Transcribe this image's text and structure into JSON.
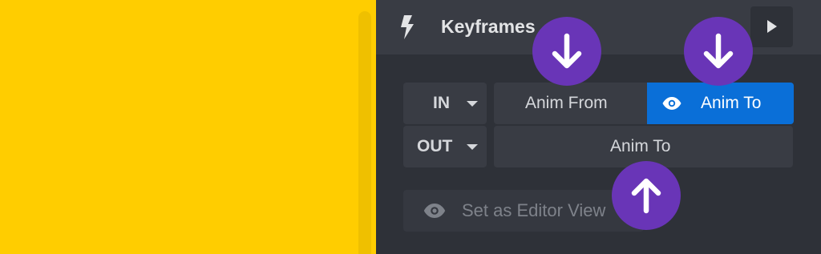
{
  "header": {
    "icon": "lightning-bolt-icon",
    "title": "Keyframes",
    "play_icon": "play-icon"
  },
  "in_row": {
    "select_label": "IN",
    "anim_from_label": "Anim From",
    "anim_to_label": "Anim To",
    "active": "Anim To"
  },
  "out_row": {
    "select_label": "OUT",
    "anim_to_label": "Anim To"
  },
  "editor_view": {
    "label": "Set as Editor View",
    "icon": "eye-icon"
  },
  "annotations": [
    {
      "icon": "arrow-down-icon"
    },
    {
      "icon": "arrow-down-icon"
    },
    {
      "icon": "arrow-up-icon"
    }
  ],
  "colors": {
    "canvas": "#ffcd00",
    "panel": "#2e3138",
    "active_button": "#0a6fd8",
    "annotation_badge": "#6935b7"
  }
}
